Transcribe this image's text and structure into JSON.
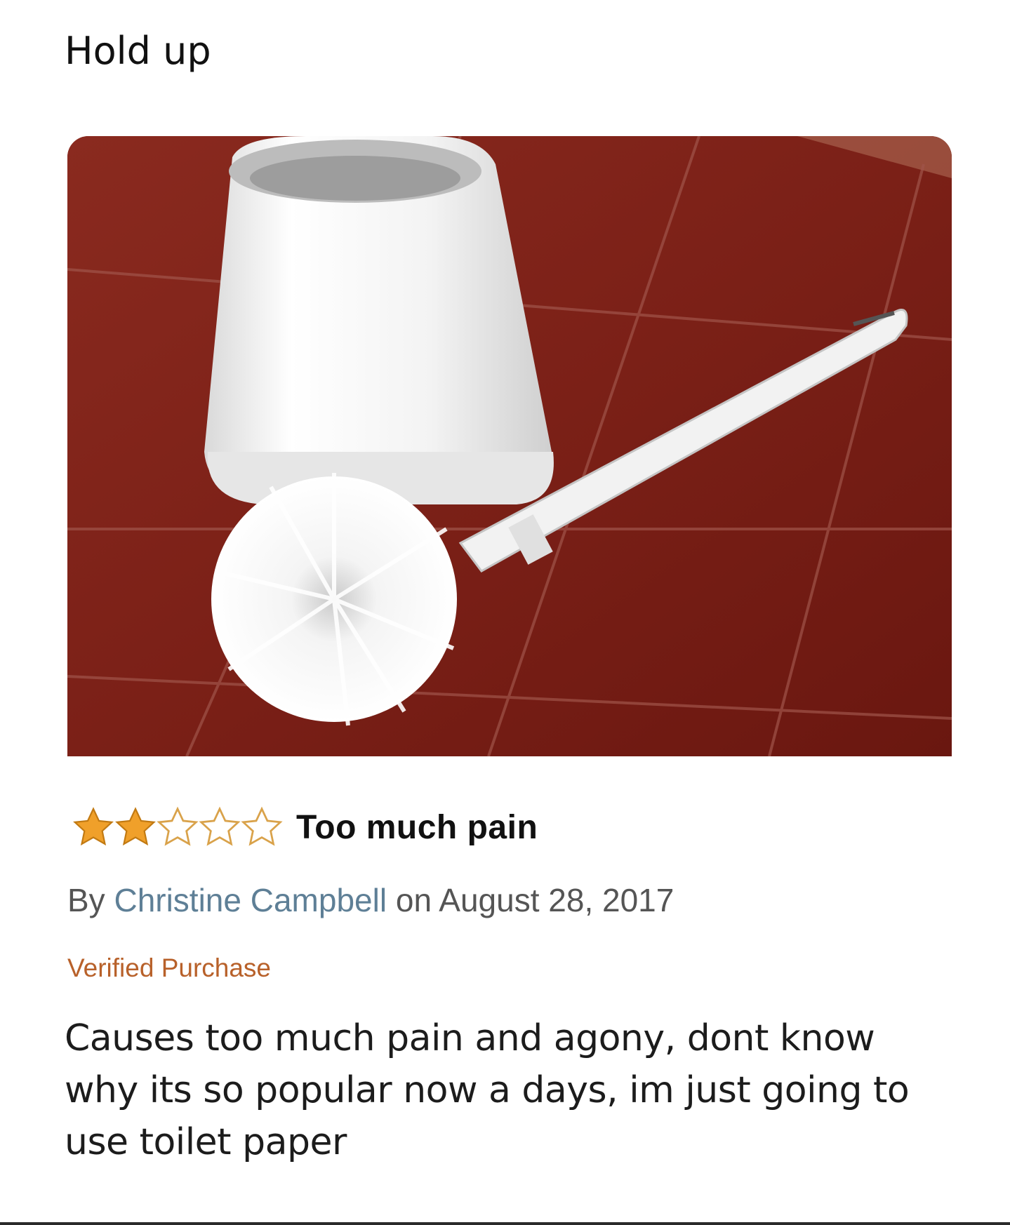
{
  "post": {
    "caption": "Hold up"
  },
  "review": {
    "rating": 2,
    "rating_max": 5,
    "title": "Too much pain",
    "byline_prefix": "By",
    "author": "Christine Campbell",
    "date_prefix": "on",
    "date": "August 28, 2017",
    "badge": "Verified Purchase",
    "body": "Causes too much pain and agony, dont know why its so popular now a days, im just going to use toilet paper"
  },
  "colors": {
    "star_filled": "#f0a02a",
    "star_outline": "#d9a24a",
    "author_link": "#5e7f96",
    "verified": "#b8612a",
    "tile": "#7a1f18"
  },
  "icons": {
    "star_filled": "star-filled-icon",
    "star_empty": "star-empty-icon"
  }
}
